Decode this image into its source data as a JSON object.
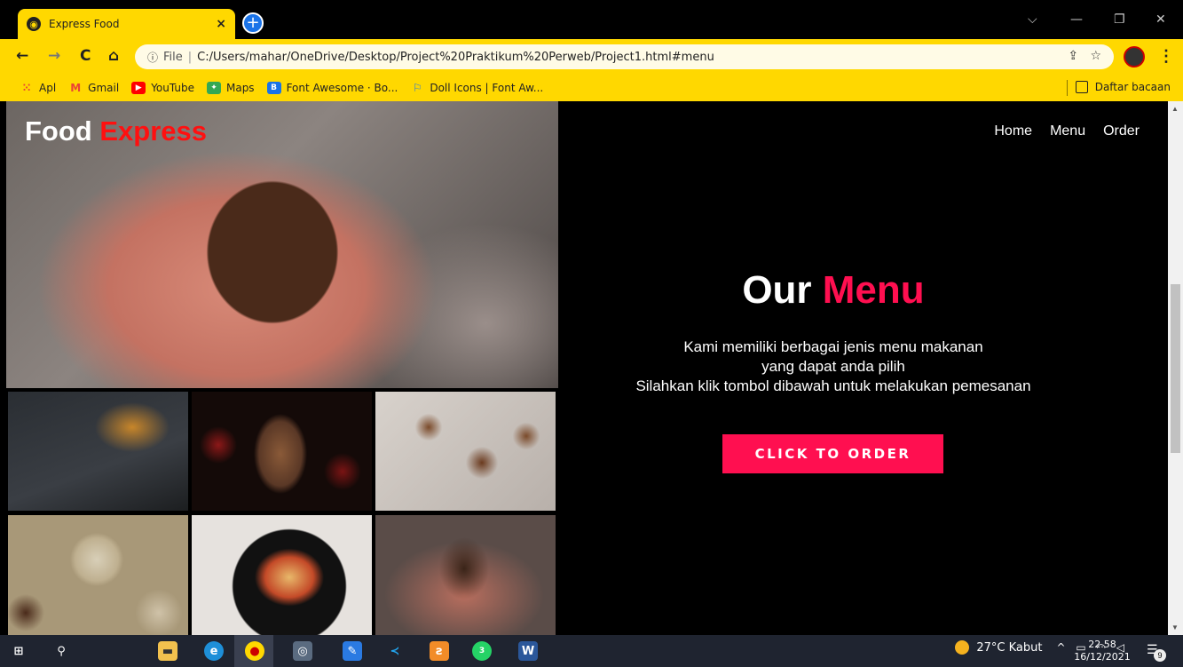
{
  "browser": {
    "tab_title": "Express Food",
    "tab_close": "×",
    "new_tab": "+",
    "window_controls": {
      "dropdown": "⌵",
      "minimize": "—",
      "restore": "❐",
      "close": "✕"
    },
    "nav": {
      "back": "←",
      "forward": "→",
      "reload": "C",
      "home": "⌂"
    },
    "address": {
      "scheme": "File",
      "url": "C:/Users/mahar/OneDrive/Desktop/Project%20Praktikum%20Perweb/Project1.html#menu"
    },
    "bookmarks": [
      {
        "label": "Apl",
        "icon": "apps-grid-icon",
        "color": "#e94235"
      },
      {
        "label": "Gmail",
        "icon": "gmail-icon",
        "color": "#ea4335"
      },
      {
        "label": "YouTube",
        "icon": "youtube-icon",
        "color": "#ff0000"
      },
      {
        "label": "Maps",
        "icon": "maps-icon",
        "color": "#34a853"
      },
      {
        "label": "Font Awesome · Bo...",
        "icon": "bootstrap-icon",
        "color": "#1a73e8"
      },
      {
        "label": "Doll Icons | Font Aw...",
        "icon": "flag-icon",
        "color": "#1a73e8"
      }
    ],
    "reading_list": "Daftar bacaan"
  },
  "page": {
    "brand": {
      "part1": "Food",
      "part2": "Express"
    },
    "nav": [
      "Home",
      "Menu",
      "Order"
    ],
    "heading": {
      "part1": "Our",
      "part2": "Menu"
    },
    "description": [
      "Kami memiliki berbagai jenis menu makanan",
      "yang dapat anda pilih",
      "Silahkan klik tombol dibawah untuk melakukan pemesanan"
    ],
    "cta": "CLICK TO ORDER",
    "colors": {
      "brand_accent": "#ff1010",
      "heading_accent": "#ff0f50",
      "cta_bg": "#ff0f50",
      "background": "#000000"
    }
  },
  "taskbar": {
    "weather": "27°C  Kabut",
    "time": "22.58",
    "date": "16/12/2021",
    "notifications": "9",
    "whatsapp_badge": "3"
  }
}
